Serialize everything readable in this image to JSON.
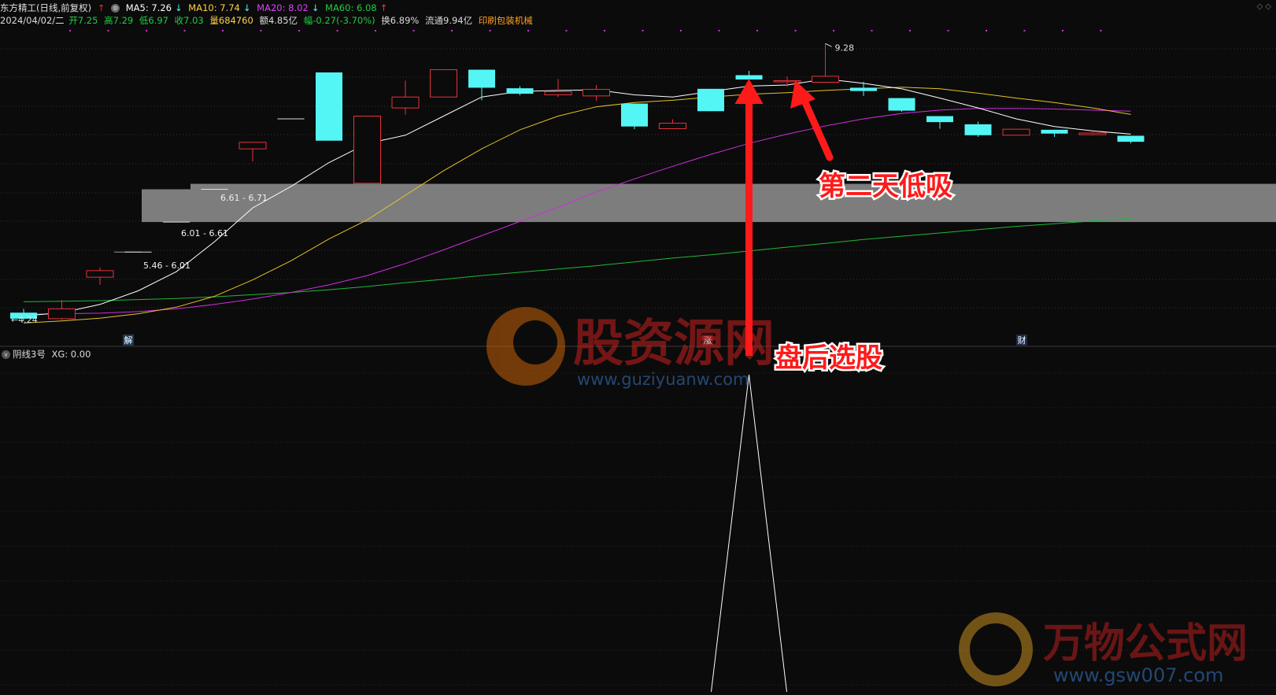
{
  "header": {
    "title": "东方精工(日线,前复权)",
    "ma": [
      {
        "label": "MA5: 7.26",
        "arrow": "↓",
        "color": "#ffffff"
      },
      {
        "label": "MA10: 7.74",
        "arrow": "↓",
        "color": "#ffd24a"
      },
      {
        "label": "MA20: 8.02",
        "arrow": "↓",
        "color": "#e040ff"
      },
      {
        "label": "MA60: 6.08",
        "arrow": "↑",
        "color": "#22cc44"
      }
    ],
    "date": "2024/04/02/二",
    "open": "开7.25",
    "high": "高7.29",
    "low": "低6.97",
    "close": "收7.03",
    "volume": "量684760",
    "amount": "额4.85亿",
    "change": "幅-0.27(-3.70%)",
    "turnover": "换6.89%",
    "float": "流通9.94亿",
    "sector": "印刷包装机械"
  },
  "colors": {
    "up": "#e8323c",
    "down": "#54f5f5",
    "ma5": "#ffffff",
    "ma10": "#e6c228",
    "ma20": "#d02de0",
    "ma60": "#1fb83a",
    "band": "#7d7d7d",
    "arrow": "#ff1a1a",
    "grid": "#333333"
  },
  "price_labels": {
    "high_mark": "9.28",
    "low_mark": "4.24",
    "band_top": "6.61 - 6.71",
    "band_mid": "6.01 - 6.61",
    "band_low": "5.46 - 6.01"
  },
  "markers": {
    "jie": "解",
    "zhang": "涨",
    "cai": "财"
  },
  "annotations": {
    "second_day": "第二天低吸",
    "after_close": "盘后选股"
  },
  "watermarks": {
    "brand1": "股资源网",
    "url1": "www.guziyuanw.com",
    "brand2": "万物公式网",
    "url2": "www.gsw007.com"
  },
  "indicator": {
    "title": "阴线3号",
    "xg": "XG: 0.00"
  },
  "chart_data": {
    "type": "candlestick",
    "y_range": [
      3.95,
      9.5
    ],
    "candles": [
      {
        "o": 4.35,
        "c": 4.24,
        "h": 4.42,
        "l": 4.2
      },
      {
        "o": 4.24,
        "c": 4.42,
        "h": 4.58,
        "l": 4.22
      },
      {
        "o": 5.0,
        "c": 5.12,
        "h": 5.18,
        "l": 4.86
      },
      {
        "o": 5.46,
        "c": 5.46,
        "h": 5.46,
        "l": 5.46
      },
      {
        "o": 6.01,
        "c": 6.01,
        "h": 6.01,
        "l": 6.01
      },
      {
        "o": 6.61,
        "c": 6.61,
        "h": 6.61,
        "l": 6.61
      },
      {
        "o": 7.35,
        "c": 7.47,
        "h": 7.47,
        "l": 7.12
      },
      {
        "o": 7.9,
        "c": 7.9,
        "h": 7.9,
        "l": 7.9
      },
      {
        "o": 8.75,
        "c": 7.5,
        "h": 8.75,
        "l": 7.5
      },
      {
        "o": 6.72,
        "c": 7.95,
        "h": 7.95,
        "l": 6.72
      },
      {
        "o": 8.1,
        "c": 8.3,
        "h": 8.6,
        "l": 7.98
      },
      {
        "o": 8.3,
        "c": 8.8,
        "h": 8.8,
        "l": 8.3
      },
      {
        "o": 8.8,
        "c": 8.47,
        "h": 8.8,
        "l": 8.24
      },
      {
        "o": 8.46,
        "c": 8.36,
        "h": 8.5,
        "l": 8.33
      },
      {
        "o": 8.34,
        "c": 8.4,
        "h": 8.63,
        "l": 8.3
      },
      {
        "o": 8.32,
        "c": 8.44,
        "h": 8.52,
        "l": 8.23
      },
      {
        "o": 8.18,
        "c": 7.76,
        "h": 8.18,
        "l": 7.71
      },
      {
        "o": 7.72,
        "c": 7.82,
        "h": 7.89,
        "l": 7.72
      },
      {
        "o": 8.45,
        "c": 8.04,
        "h": 8.45,
        "l": 8.04
      },
      {
        "o": 8.7,
        "c": 8.62,
        "h": 8.78,
        "l": 8.57
      },
      {
        "o": 8.6,
        "c": 8.6,
        "h": 8.68,
        "l": 8.49
      },
      {
        "o": 8.57,
        "c": 8.68,
        "h": 9.28,
        "l": 8.57
      },
      {
        "o": 8.47,
        "c": 8.41,
        "h": 8.58,
        "l": 8.32
      },
      {
        "o": 8.28,
        "c": 8.05,
        "h": 8.28,
        "l": 8.03
      },
      {
        "o": 7.95,
        "c": 7.84,
        "h": 7.95,
        "l": 7.72
      },
      {
        "o": 7.8,
        "c": 7.6,
        "h": 7.85,
        "l": 7.57
      },
      {
        "o": 7.6,
        "c": 7.71,
        "h": 7.71,
        "l": 7.6
      },
      {
        "o": 7.7,
        "c": 7.63,
        "h": 7.7,
        "l": 7.57
      },
      {
        "o": 7.61,
        "c": 7.64,
        "h": 7.66,
        "l": 7.6
      },
      {
        "o": 7.59,
        "c": 7.48,
        "h": 7.59,
        "l": 7.45
      }
    ],
    "ma5": [
      4.29,
      4.35,
      4.5,
      4.75,
      5.1,
      5.65,
      6.27,
      6.66,
      7.1,
      7.45,
      7.6,
      7.95,
      8.3,
      8.4,
      8.42,
      8.43,
      8.34,
      8.3,
      8.4,
      8.5,
      8.52,
      8.63,
      8.55,
      8.45,
      8.28,
      8.1,
      7.9,
      7.76,
      7.68,
      7.62
    ],
    "ma10": [
      4.16,
      4.2,
      4.25,
      4.33,
      4.45,
      4.65,
      4.95,
      5.3,
      5.7,
      6.05,
      6.5,
      6.95,
      7.35,
      7.7,
      7.95,
      8.12,
      8.2,
      8.24,
      8.3,
      8.35,
      8.38,
      8.42,
      8.45,
      8.48,
      8.45,
      8.37,
      8.28,
      8.2,
      8.1,
      7.98
    ],
    "ma20": [
      4.32,
      4.33,
      4.34,
      4.37,
      4.42,
      4.5,
      4.6,
      4.72,
      4.86,
      5.03,
      5.25,
      5.5,
      5.76,
      6.02,
      6.28,
      6.56,
      6.8,
      7.03,
      7.25,
      7.45,
      7.62,
      7.77,
      7.9,
      8.0,
      8.06,
      8.09,
      8.09,
      8.08,
      8.06,
      8.04
    ],
    "ma60": [
      4.55,
      4.56,
      4.57,
      4.59,
      4.61,
      4.64,
      4.68,
      4.72,
      4.77,
      4.83,
      4.9,
      4.96,
      5.03,
      5.09,
      5.15,
      5.21,
      5.28,
      5.35,
      5.41,
      5.48,
      5.55,
      5.62,
      5.69,
      5.75,
      5.81,
      5.87,
      5.93,
      5.98,
      6.03,
      6.08
    ],
    "bands": [
      {
        "lo": 6.61,
        "hi": 6.71
      },
      {
        "lo": 6.01,
        "hi": 6.61
      },
      {
        "lo": 5.46,
        "hi": 6.01
      }
    ],
    "xg_signal_index": 19
  }
}
